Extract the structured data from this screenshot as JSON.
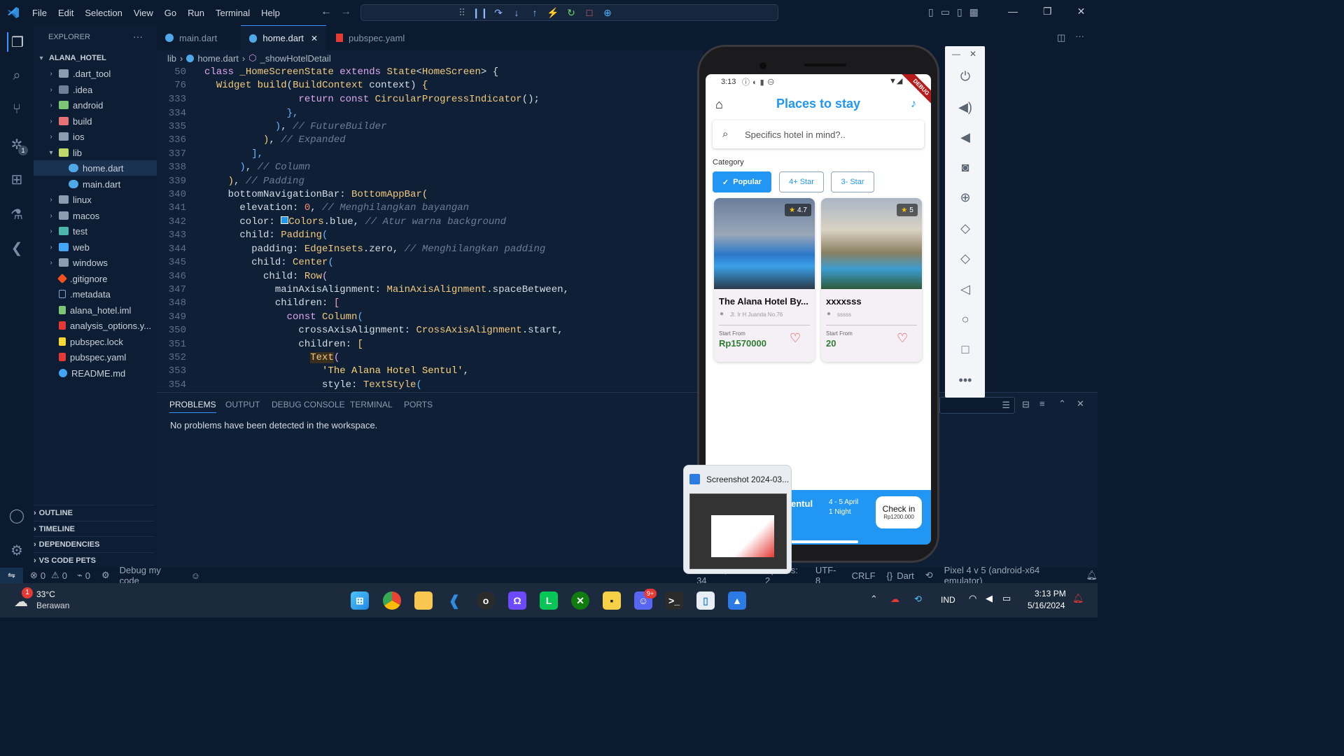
{
  "menu": [
    "File",
    "Edit",
    "Selection",
    "View",
    "Go",
    "Run",
    "Terminal",
    "Help"
  ],
  "explorer": {
    "title": "EXPLORER",
    "project": "ALANA_HOTEL",
    "items": [
      {
        "label": ".dart_tool",
        "kind": "folder"
      },
      {
        "label": ".idea",
        "kind": "folder"
      },
      {
        "label": "android",
        "kind": "folder"
      },
      {
        "label": "build",
        "kind": "folder"
      },
      {
        "label": "ios",
        "kind": "folder"
      },
      {
        "label": "lib",
        "kind": "folder-open"
      },
      {
        "label": "home.dart",
        "kind": "dart"
      },
      {
        "label": "main.dart",
        "kind": "dart"
      },
      {
        "label": "linux",
        "kind": "folder"
      },
      {
        "label": "macos",
        "kind": "folder"
      },
      {
        "label": "test",
        "kind": "folder"
      },
      {
        "label": "web",
        "kind": "folder"
      },
      {
        "label": "windows",
        "kind": "folder"
      },
      {
        "label": ".gitignore",
        "kind": "file"
      },
      {
        "label": ".metadata",
        "kind": "file"
      },
      {
        "label": "alana_hotel.iml",
        "kind": "file"
      },
      {
        "label": "analysis_options.y...",
        "kind": "file"
      },
      {
        "label": "pubspec.lock",
        "kind": "file"
      },
      {
        "label": "pubspec.yaml",
        "kind": "file"
      },
      {
        "label": "README.md",
        "kind": "file"
      }
    ],
    "sections": [
      "OUTLINE",
      "TIMELINE",
      "DEPENDENCIES",
      "VS CODE PETS"
    ]
  },
  "tabs": [
    {
      "label": "main.dart"
    },
    {
      "label": "home.dart"
    },
    {
      "label": "pubspec.yaml"
    }
  ],
  "breadcrumb": [
    "lib",
    "home.dart",
    "_showHotelDetail"
  ],
  "code": {
    "line_numbers": [
      "50",
      "76",
      "333",
      "334",
      "335",
      "336",
      "337",
      "338",
      "339",
      "340",
      "341",
      "342",
      "343",
      "344",
      "345",
      "346",
      "347",
      "348",
      "349",
      "350",
      "351",
      "352",
      "353",
      "354"
    ]
  },
  "panel": {
    "tabs": [
      "PROBLEMS",
      "OUTPUT",
      "DEBUG CONSOLE",
      "TERMINAL",
      "PORTS"
    ],
    "message": "No problems have been detected in the workspace."
  },
  "status": {
    "errors": "0",
    "warnings": "0",
    "ports": "0",
    "debug": "Debug my code",
    "position": "Ln 647, Col 34",
    "spaces": "Spaces: 2",
    "encoding": "UTF-8",
    "eol": "CRLF",
    "language": "Dart",
    "device": "Pixel 4 v 5 (android-x64 emulator)"
  },
  "phone": {
    "time": "3:13",
    "debug_banner": "DEBUG",
    "title": "Places to stay",
    "search_placeholder": "Specifics hotel in mind?..",
    "category_label": "Category",
    "chips": [
      "Popular",
      "4+ Star",
      "3- Star"
    ],
    "cards": [
      {
        "name": "The Alana Hotel By...",
        "address": "Jl. Ir H Juanda No.76",
        "rating": "4.7",
        "from_label": "Start From",
        "price": "Rp1570000"
      },
      {
        "name": "xxxxsss",
        "address": "sssss",
        "rating": "5",
        "from_label": "Start From",
        "price": "20"
      }
    ],
    "bottom": {
      "name": "entul",
      "dates": "4 - 5 April",
      "nights": "1 Night",
      "button": "Check in",
      "button_price": "Rp1200.000"
    }
  },
  "thumbnail": {
    "title": "Screenshot 2024-03..."
  },
  "weather": {
    "temp": "33°C",
    "desc": "Berawan",
    "badge": "1"
  },
  "tray": {
    "lang": "IND",
    "time": "3:13 PM",
    "date": "5/16/2024"
  },
  "badges": {
    "debug": "1",
    "discord": "9+"
  },
  "colors": {
    "accent": "#2196f3",
    "price": "#2e7d32",
    "heart": "#e53935"
  }
}
